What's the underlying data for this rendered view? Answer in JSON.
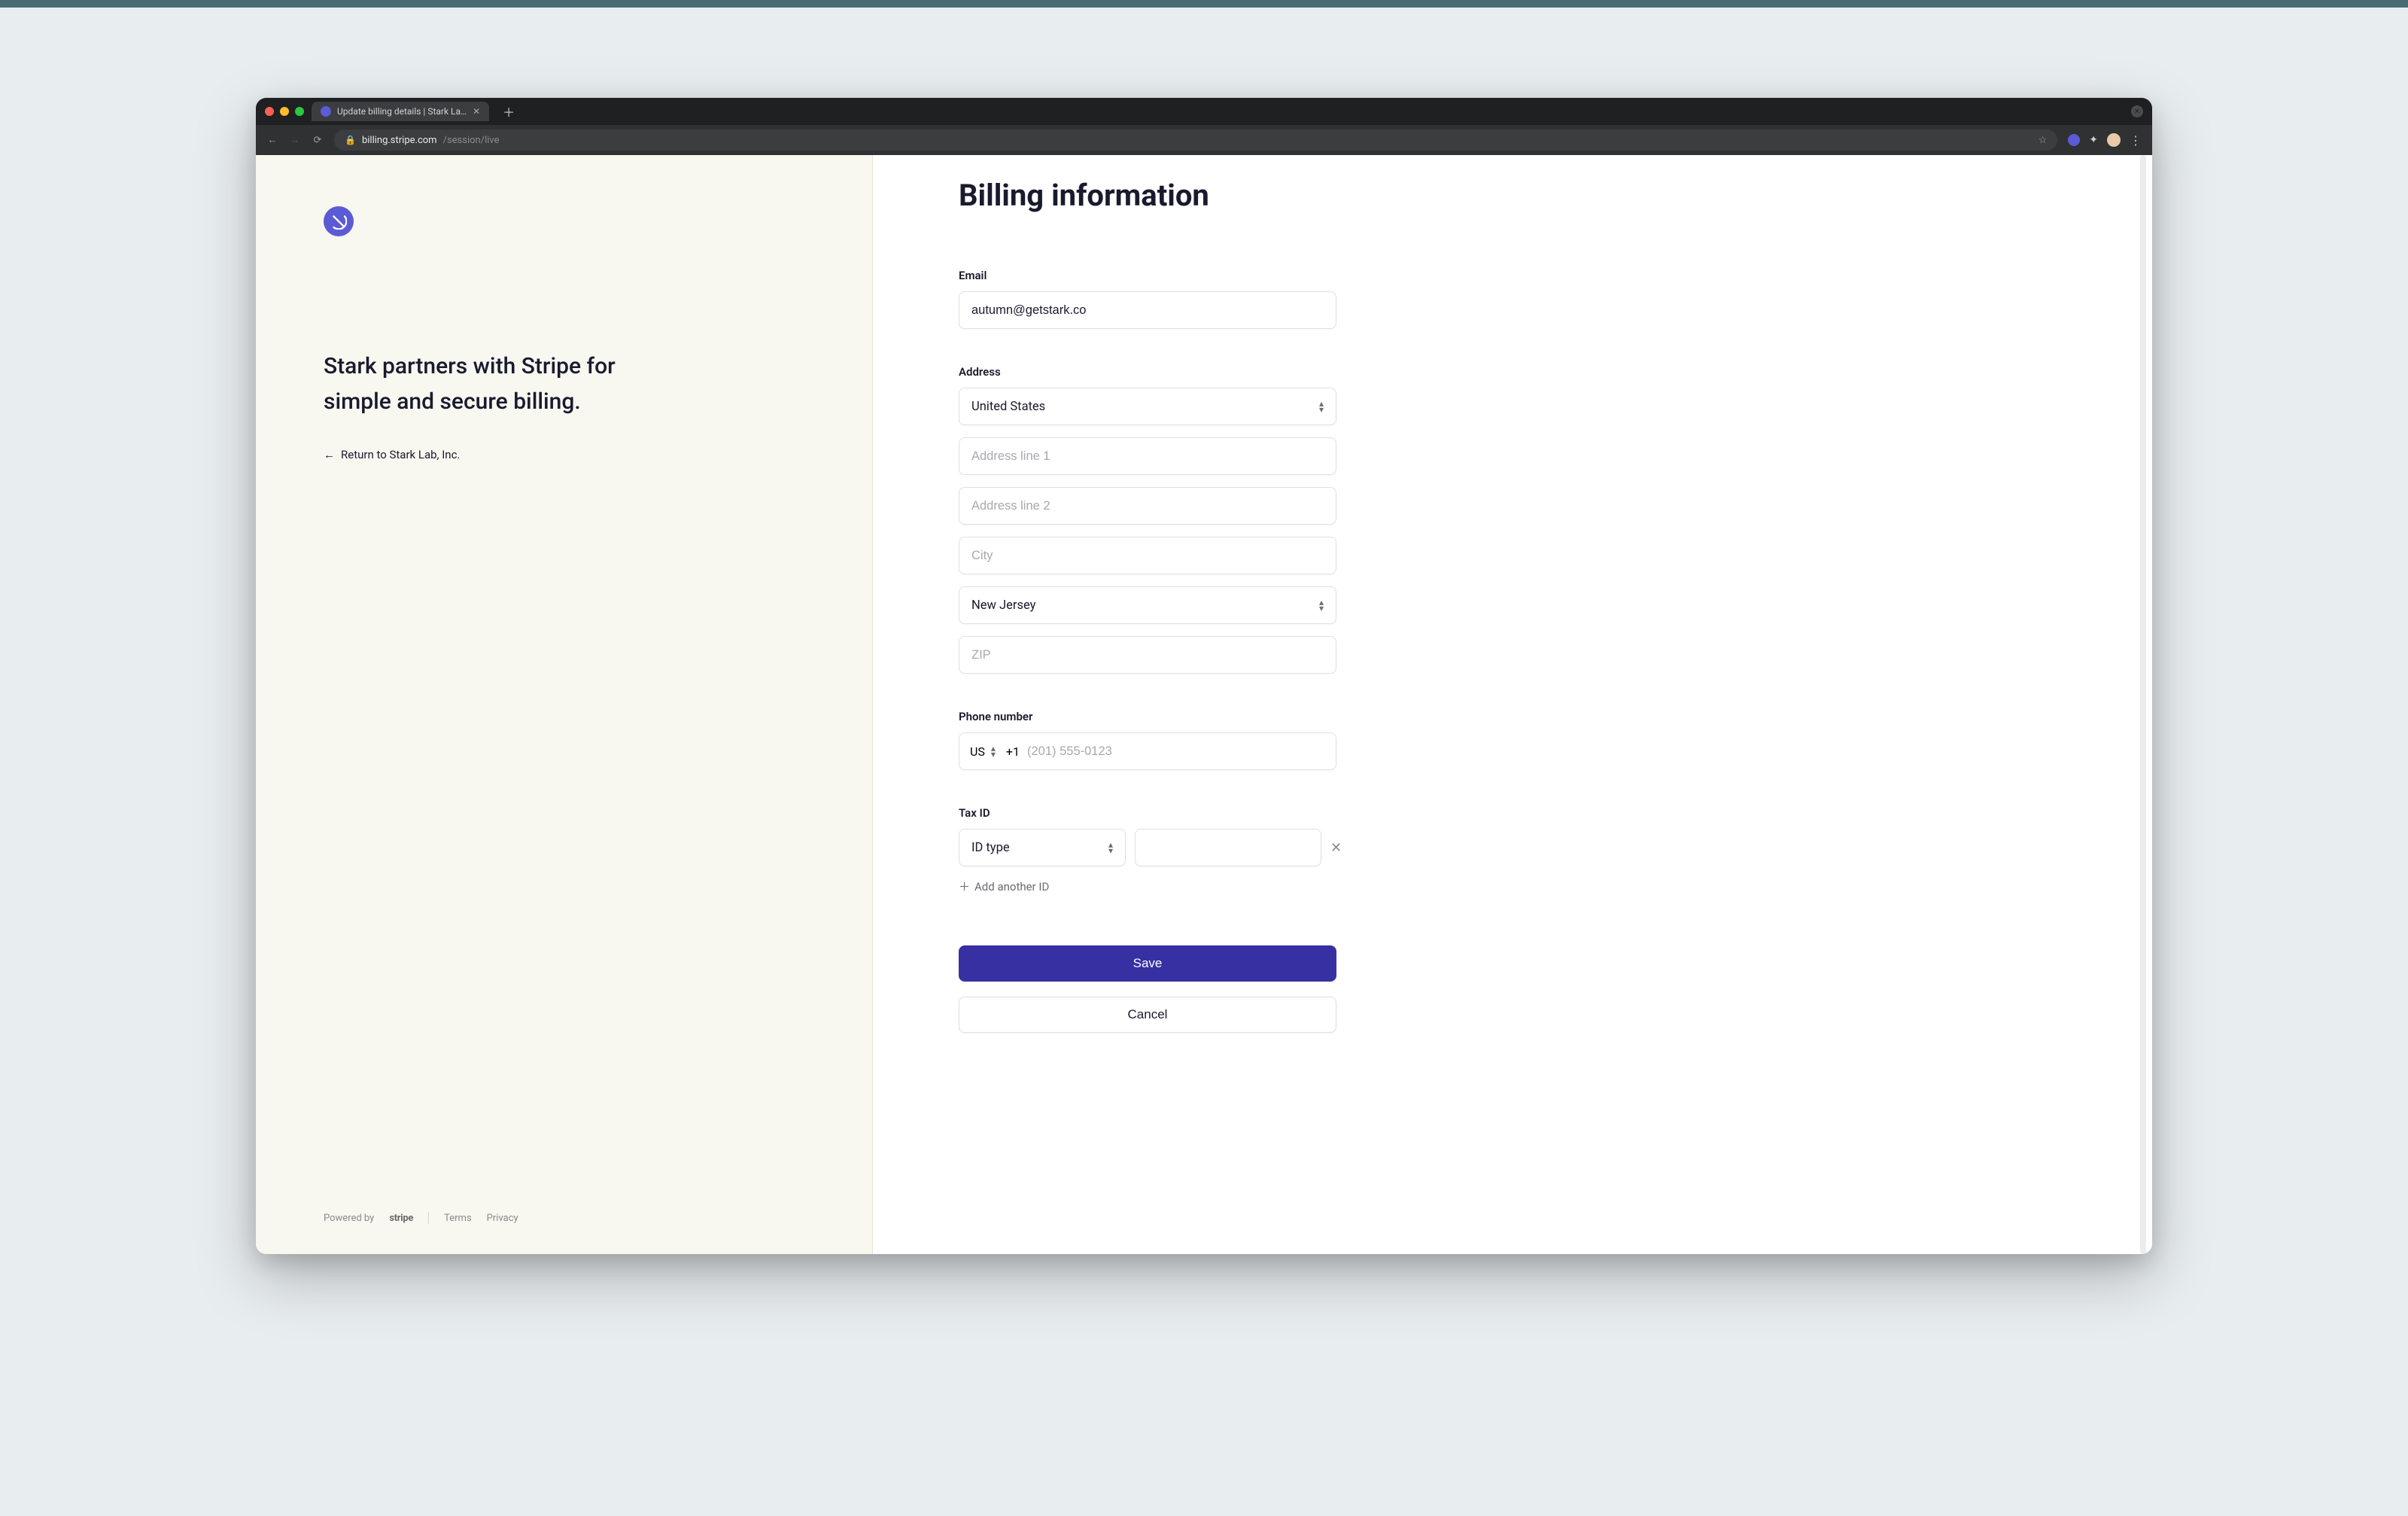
{
  "browser": {
    "tab_title": "Update billing details | Stark La…",
    "url_host": "billing.stripe.com",
    "url_path": "/session/live"
  },
  "sidebar": {
    "tagline": "Stark partners with Stripe for simple and secure billing.",
    "return_label": "Return to Stark Lab, Inc.",
    "powered_by": "Powered by",
    "brand": "stripe",
    "terms": "Terms",
    "privacy": "Privacy"
  },
  "form": {
    "title": "Billing information",
    "email_label": "Email",
    "email_value": "autumn@getstark.co",
    "address_label": "Address",
    "country_value": "United States",
    "line1_placeholder": "Address line 1",
    "line2_placeholder": "Address line 2",
    "city_placeholder": "City",
    "state_value": "New Jersey",
    "zip_placeholder": "ZIP",
    "phone_label": "Phone number",
    "phone_cc_label": "US",
    "phone_prefix": "+1",
    "phone_placeholder": "(201) 555-0123",
    "taxid_label": "Tax ID",
    "taxid_type_value": "ID type",
    "add_another_label": "Add another ID",
    "save_label": "Save",
    "cancel_label": "Cancel"
  }
}
